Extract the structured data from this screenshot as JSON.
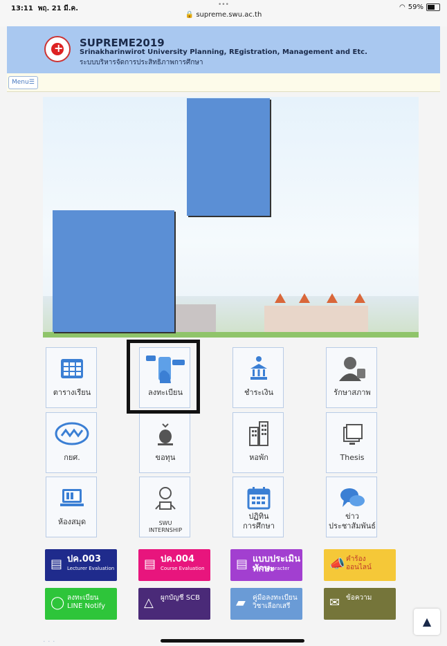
{
  "status_bar": {
    "time": "13:11",
    "date": "พฤ. 21 มี.ค.",
    "dots": "•••",
    "url": "supreme.swu.ac.th",
    "battery": "59%"
  },
  "header": {
    "title": "SUPREME2019",
    "subtitle": "Srinakharinwirot University Planning, REgistration, Management and Etc.",
    "thai_subtitle": "ระบบบริหารจัดการประสิทธิภาพการศึกษา",
    "bg_color": "#a9c8f0"
  },
  "menu": {
    "label": "Menu☰"
  },
  "tiles": [
    {
      "label": "ตารางเรียน",
      "icon": "timetable-icon",
      "color": "#3b7fd4"
    },
    {
      "label": "ลงทะเบียน",
      "icon": "phone-registration-icon",
      "color": "#3b7fd4",
      "highlighted": true
    },
    {
      "label": "ชำระเงิน",
      "icon": "bank-payment-icon",
      "color": "#3b7fd4"
    },
    {
      "label": "รักษาสภาพ",
      "icon": "person-status-icon",
      "color": "#555555"
    },
    {
      "label": "กยศ.",
      "icon": "student-loan-icon",
      "color": "#3b7fd4"
    },
    {
      "label": "ขอทุน",
      "icon": "money-bag-icon",
      "color": "#555555"
    },
    {
      "label": "หอพัก",
      "icon": "dormitory-building-icon",
      "color": "#555555"
    },
    {
      "label": "Thesis",
      "icon": "thesis-icon",
      "color": "#555555"
    },
    {
      "label": "ห้องสมุด",
      "icon": "laptop-library-icon",
      "color": "#3b7fd4"
    },
    {
      "label": "SWU\nINTERNSHIP",
      "icon": "internship-reader-icon",
      "color": "#555555"
    },
    {
      "label": "ปฏิทิน\nการศึกษา",
      "icon": "calendar-icon",
      "color": "#3b7fd4"
    },
    {
      "label": "ข่าว\nประชาสัมพันธ์",
      "icon": "chat-bubbles-icon",
      "color": "#3b7fd4"
    }
  ],
  "buttons": [
    {
      "title": "ปค.003",
      "sub": "Lecturer Evaluation",
      "color": "#1f2b8c",
      "icon": "survey-icon"
    },
    {
      "title": "ปค.004",
      "sub": "Course Evaluation",
      "color": "#e8157d",
      "icon": "survey-icon"
    },
    {
      "title": "แบบประเมินทักษะ",
      "sub": "SWU Character",
      "color": "#a23fd0",
      "icon": "survey-icon"
    },
    {
      "title": "คำร้อง\nออนไลน์",
      "sub": "",
      "color": "#f5c838",
      "icon": "megaphone-icon"
    },
    {
      "title": "ลงทะเบียน\nLINE Notify",
      "sub": "",
      "color": "#2ec53a",
      "icon": "line-icon"
    },
    {
      "title": "ผูกบัญชี SCB",
      "sub": "",
      "color": "#4a2a78",
      "icon": "scb-icon"
    },
    {
      "title": "คู่มือลงทะเบียน\nวิชาเลือกเสรี",
      "sub": "",
      "color": "#6a9bd6",
      "icon": "manual-icon"
    },
    {
      "title": "ข้อความ",
      "sub": "",
      "color": "#75753a",
      "icon": "mail-icon"
    }
  ],
  "to_top": "▲"
}
